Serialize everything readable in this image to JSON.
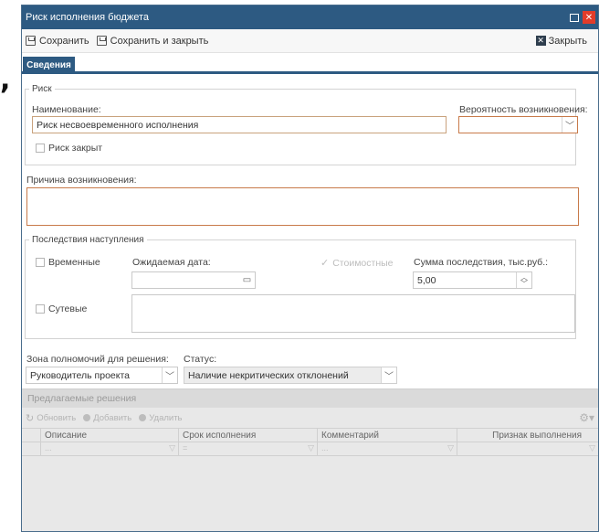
{
  "window": {
    "title": "Риск исполнения бюджета"
  },
  "toolbar": {
    "save": "Сохранить",
    "save_close": "Сохранить и закрыть",
    "close": "Закрыть"
  },
  "tabs": [
    {
      "label": "Сведения",
      "active": true
    }
  ],
  "risk": {
    "legend": "Риск",
    "name_label": "Наименование:",
    "name_value": "Риск несвоевременного исполнения",
    "probability_label": "Вероятность возникновения:",
    "probability_value": "",
    "closed_label": "Риск закрыт"
  },
  "cause": {
    "label": "Причина возникновения:",
    "value": ""
  },
  "consequences": {
    "legend": "Последствия наступления",
    "temporal_label": "Временные",
    "expected_date_label": "Ожидаемая дата:",
    "expected_date_value": "",
    "cost_label": "Стоимостные",
    "sum_label": "Сумма последствия, тыс.руб.:",
    "sum_value": "5,00",
    "essential_label": "Сутевые",
    "essential_value": ""
  },
  "authority": {
    "label": "Зона полномочий для решения:",
    "value": "Руководитель проекта"
  },
  "status": {
    "label": "Статус:",
    "value": "Наличие некритических отклонений"
  },
  "solutions": {
    "title": "Предлагаемые решения",
    "tools": {
      "refresh": "Обновить",
      "add": "Добавить",
      "delete": "Удалить"
    },
    "columns": [
      "Описание",
      "Срок исполнения",
      "Комментарий",
      "Признак выполнения"
    ],
    "filters": [
      "...",
      "=",
      "...",
      ""
    ]
  },
  "colors": {
    "accent": "#2d5a82",
    "close": "#e23c2a",
    "required_border": "#c87a4a"
  }
}
